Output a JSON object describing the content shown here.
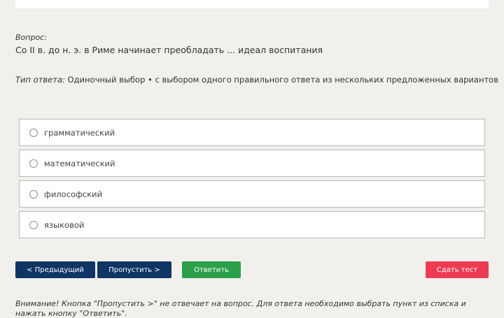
{
  "question": {
    "label": "Вопрос:",
    "text": "Со II в. до н. э. в Риме начинает преобладать ... идеал воспитания"
  },
  "answer_type": {
    "label": "Тип ответа:",
    "text": "Одиночный выбор • с выбором одного правильного ответа из нескольких предложенных вариантов"
  },
  "options": [
    {
      "label": "грамматический"
    },
    {
      "label": "математический"
    },
    {
      "label": "философский"
    },
    {
      "label": "языковой"
    }
  ],
  "buttons": {
    "prev": "< Предыдущий",
    "skip": "Пропустить >",
    "answer": "Ответить",
    "finish": "Сдать тест"
  },
  "note": "Внимание! Кнопка \"Пропустить >\" не отвечает на вопрос. Для ответа необходимо выбрать пункт из списка и нажать кнопку \"Ответить\".",
  "colors": {
    "background": "#f2f0ec",
    "primary_button": "#0f3565",
    "answer_button": "#2aa04a",
    "finish_button": "#ee3b54"
  }
}
